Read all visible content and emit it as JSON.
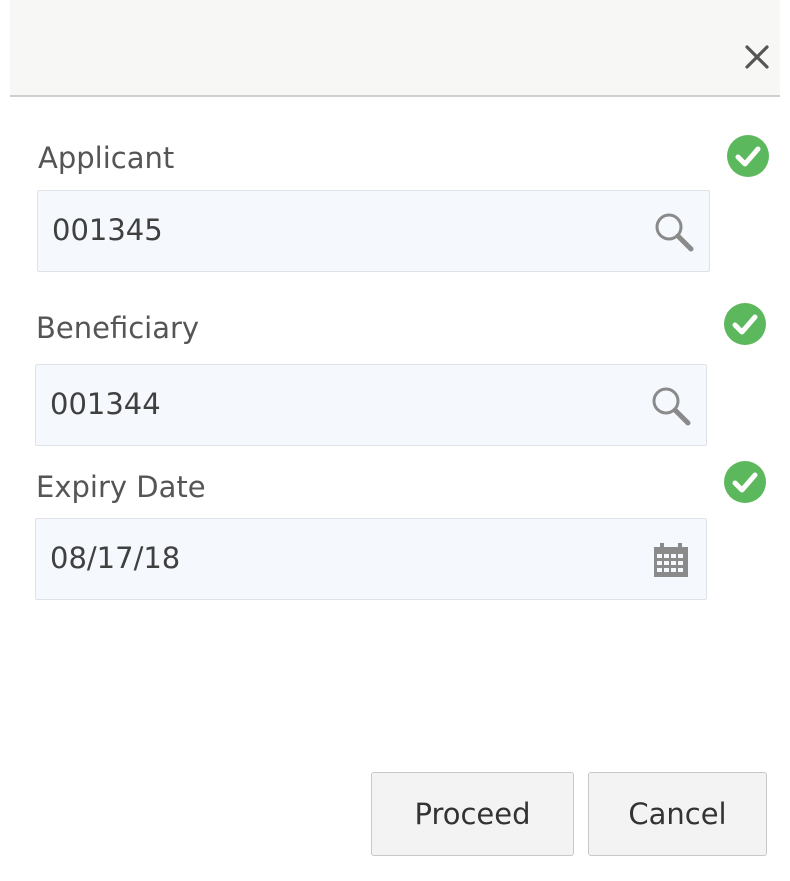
{
  "dialog": {
    "close_icon": "close-icon",
    "fields": [
      {
        "label": "Applicant",
        "value": "001345",
        "icon": "search-icon",
        "status": "valid"
      },
      {
        "label": "Beneficiary",
        "value": "001344",
        "icon": "search-icon",
        "status": "valid"
      },
      {
        "label": "Expiry Date",
        "value": "08/17/18",
        "icon": "calendar-icon",
        "status": "valid"
      }
    ],
    "actions": {
      "proceed_label": "Proceed",
      "cancel_label": "Cancel"
    }
  },
  "colors": {
    "valid_green": "#5cb85c",
    "header_bg": "#f7f7f6",
    "input_bg": "#f5f8fc",
    "button_bg": "#f3f3f3"
  }
}
